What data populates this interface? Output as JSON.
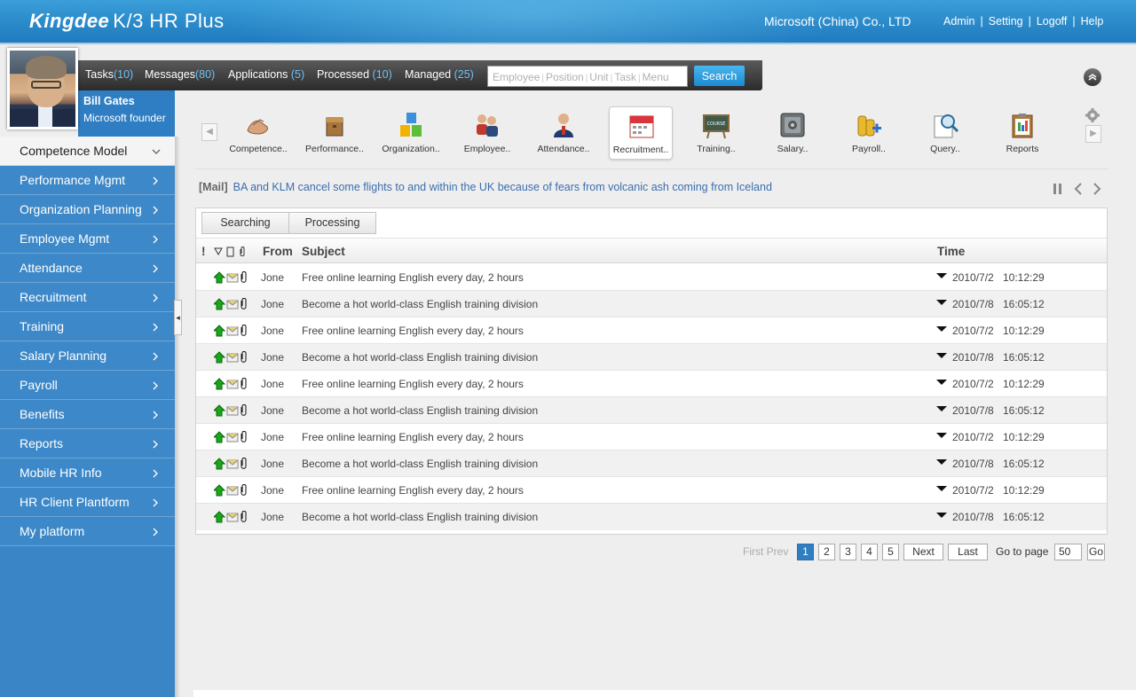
{
  "header": {
    "brand": "Kingdee",
    "product": "K/3 HR Plus",
    "company": "Microsoft (China) Co., LTD",
    "links": [
      "Admin",
      "Setting",
      "Logoff",
      "Help"
    ]
  },
  "user": {
    "name": "Bill Gates",
    "title": "Microsoft founder"
  },
  "taskbar": {
    "items": [
      {
        "label": "Tasks",
        "count": "(10)"
      },
      {
        "label": "Messages",
        "count": "(80)"
      },
      {
        "label": "Applications",
        "count": "(5)"
      },
      {
        "label": "Processed",
        "count": "(10)"
      },
      {
        "label": "Managed",
        "count": "(25)"
      }
    ],
    "search_placeholder_parts": [
      "Employee",
      "Position",
      "Unit",
      "Task",
      "Menu"
    ],
    "search_button": "Search"
  },
  "sidebar": {
    "items": [
      "Competence Model",
      "Performance Mgmt",
      "Organization Planning",
      "Employee Mgmt",
      "Attendance",
      "Recruitment",
      "Training",
      "Salary Planning",
      "Payroll",
      "Benefits",
      "Reports",
      "Mobile HR Info",
      "HR Client Plantform",
      "My platform"
    ]
  },
  "apps": [
    {
      "label": "Competence..",
      "icon": "handshake-icon"
    },
    {
      "label": "Performance..",
      "icon": "box-icon"
    },
    {
      "label": "Organization..",
      "icon": "blocks-icon"
    },
    {
      "label": "Employee..",
      "icon": "people-icon"
    },
    {
      "label": "Attendance..",
      "icon": "person-icon"
    },
    {
      "label": "Recruitment..",
      "icon": "calendar-icon"
    },
    {
      "label": "Training..",
      "icon": "chalkboard-icon"
    },
    {
      "label": "Salary..",
      "icon": "safe-icon"
    },
    {
      "label": "Payroll..",
      "icon": "coins-icon"
    },
    {
      "label": "Query..",
      "icon": "magnifier-icon"
    },
    {
      "label": "Reports",
      "icon": "clipboard-icon"
    }
  ],
  "course_text": "COURSE",
  "ticker": {
    "tag": "[Mail]",
    "message": "BA and KLM cancel some flights to and within the UK because of fears from volcanic ash coming from Iceland"
  },
  "tabs": [
    "Searching",
    "Processing"
  ],
  "columns": {
    "flag": "!",
    "from": "From",
    "subject": "Subject",
    "time": "Time"
  },
  "rows": [
    {
      "from": "Jone",
      "subject": "Free online learning English every day, 2 hours",
      "date": "2010/7/2",
      "time": "10:12:29"
    },
    {
      "from": "Jone",
      "subject": "Become a hot world-class English training division",
      "date": "2010/7/8",
      "time": "16:05:12"
    },
    {
      "from": "Jone",
      "subject": "Free online learning English every day, 2 hours",
      "date": "2010/7/2",
      "time": "10:12:29"
    },
    {
      "from": "Jone",
      "subject": "Become a hot world-class English training division",
      "date": "2010/7/8",
      "time": "16:05:12"
    },
    {
      "from": "Jone",
      "subject": "Free online learning English every day, 2 hours",
      "date": "2010/7/2",
      "time": "10:12:29"
    },
    {
      "from": "Jone",
      "subject": "Become a hot world-class English training division",
      "date": "2010/7/8",
      "time": "16:05:12"
    },
    {
      "from": "Jone",
      "subject": "Free online learning English every day, 2 hours",
      "date": "2010/7/2",
      "time": "10:12:29"
    },
    {
      "from": "Jone",
      "subject": "Become a hot world-class English training division",
      "date": "2010/7/8",
      "time": "16:05:12"
    },
    {
      "from": "Jone",
      "subject": "Free online learning English every day, 2 hours",
      "date": "2010/7/2",
      "time": "10:12:29"
    },
    {
      "from": "Jone",
      "subject": "Become a hot world-class English training division",
      "date": "2010/7/8",
      "time": "16:05:12"
    }
  ],
  "pager": {
    "first_prev": "First Prev",
    "pages": [
      "1",
      "2",
      "3",
      "4",
      "5"
    ],
    "current": "1",
    "next": "Next",
    "last": "Last",
    "goto_label": "Go to page",
    "goto_value": "50",
    "go": "Go"
  },
  "colors": {
    "header_blue": "#2a89c9",
    "sidebar_blue": "#3d88c8",
    "link_blue": "#3b6eae",
    "accent_count": "#6cc0f5"
  }
}
